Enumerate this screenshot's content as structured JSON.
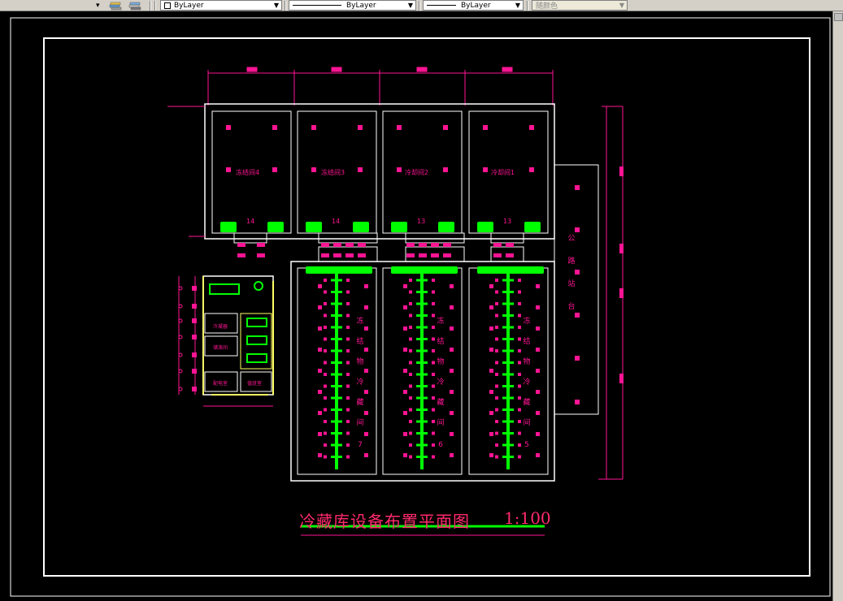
{
  "toolbar": {
    "layer_icon_a": "layers-icon",
    "layer_icon_b": "layer-states-icon",
    "color_combo": "ByLayer",
    "linetype_combo": "ByLayer",
    "lineweight_combo": "ByLayer",
    "plotstyle_combo": "随颜色"
  },
  "drawing": {
    "title": "冷藏库设备布置平面图",
    "scale": "1:100",
    "rooms_top": [
      "冻结间4",
      "冻结间3",
      "冷却间2",
      "冷却间1"
    ],
    "rooms_bottom_chars": [
      [
        "冻",
        "结",
        "物",
        "冷",
        "藏",
        "间",
        "7"
      ],
      [
        "冻",
        "结",
        "物",
        "冷",
        "藏",
        "间",
        "6"
      ],
      [
        "冻",
        "结",
        "物",
        "冷",
        "藏",
        "间",
        "5"
      ]
    ],
    "platform_chars": [
      "公",
      "路",
      "站",
      "台"
    ],
    "unit_numbers_top": [
      "14",
      "14",
      "13",
      "13"
    ],
    "machine_room_labels": [
      "冷凝器",
      "储液间",
      "配电室",
      "值班室"
    ]
  },
  "colors": {
    "background": "#000000",
    "wall": "#ffffff",
    "dimension": "#ff1493",
    "equipment": "#00ff00",
    "title": "#ff2a6d"
  }
}
